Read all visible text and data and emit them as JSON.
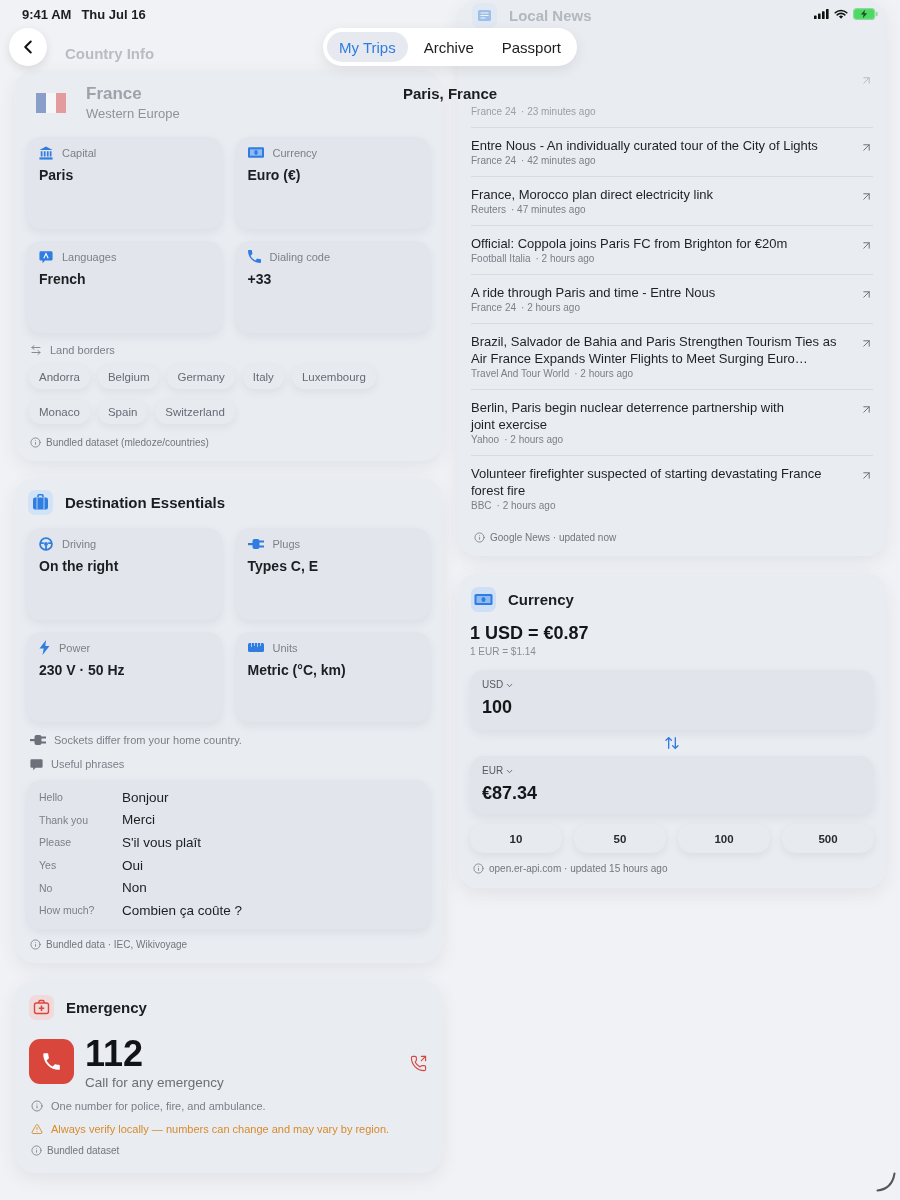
{
  "status_bar": {
    "time": "9:41 AM",
    "date": "Thu Jul 16"
  },
  "nav": {
    "title": "Country Info",
    "tabs": [
      {
        "label": "My Trips",
        "selected": true
      },
      {
        "label": "Archive",
        "selected": false
      },
      {
        "label": "Passport",
        "selected": false
      }
    ],
    "location": "Paris, France"
  },
  "country": {
    "name": "France",
    "region": "Western Europe",
    "facts": [
      {
        "kind": "capital",
        "label": "Capital",
        "value": "Paris"
      },
      {
        "kind": "currency",
        "label": "Currency",
        "value": "Euro (€)"
      },
      {
        "kind": "languages",
        "label": "Languages",
        "value": "French"
      },
      {
        "kind": "dialing",
        "label": "Dialing code",
        "value": "+33"
      }
    ],
    "borders": {
      "label": "Land borders",
      "countries": [
        "Andorra",
        "Belgium",
        "Germany",
        "Italy",
        "Luxembourg",
        "Monaco",
        "Spain",
        "Switzerland"
      ]
    },
    "source": "Bundled dataset (mledoze/countries)"
  },
  "essentials": {
    "title": "Destination Essentials",
    "facts": [
      {
        "kind": "driving",
        "label": "Driving",
        "value": "On the right"
      },
      {
        "kind": "plugs",
        "label": "Plugs",
        "value": "Types C, E"
      },
      {
        "kind": "power",
        "label": "Power",
        "value": "230 V · 50 Hz"
      },
      {
        "kind": "units",
        "label": "Units",
        "value": "Metric (°C, km)"
      }
    ],
    "notes": [
      {
        "kind": "plug",
        "text": "Sockets differ from your home country."
      }
    ],
    "phrases": {
      "label": "Useful phrases",
      "rows": [
        {
          "english": "Hello",
          "local": "Bonjour"
        },
        {
          "english": "Thank you",
          "local": "Merci"
        },
        {
          "english": "Please",
          "local": "S'il vous plaît"
        },
        {
          "english": "Yes",
          "local": "Oui"
        },
        {
          "english": "No",
          "local": "Non"
        },
        {
          "english": "How much?",
          "local": "Combien ça coûte ?"
        }
      ]
    },
    "source": "Bundled data · IEC, Wikivoyage"
  },
  "emergency": {
    "title": "Emergency",
    "number": "112",
    "caption": "Call for any emergency",
    "notes": [
      {
        "kind": "info",
        "text": "One number for police, fire, and ambulance."
      },
      {
        "kind": "warning",
        "text": "Always verify locally — numbers can change and may vary by region."
      }
    ],
    "source": "Bundled dataset"
  },
  "news": {
    "title": "Local News",
    "items": [
      {
        "faded": true,
        "source": "France 24",
        "time": "· 23 minutes ago"
      },
      {
        "faded": false,
        "title": "Entre Nous - An individually curated tour of the City of Lights",
        "source": "France 24",
        "time": "· 42 minutes ago"
      },
      {
        "faded": false,
        "title": "France, Morocco plan direct electricity link",
        "source": "Reuters",
        "time": "· 47 minutes ago"
      },
      {
        "faded": false,
        "title": "Official: Coppola joins Paris FC from Brighton for €20m",
        "source": "Football Italia",
        "time": "· 2 hours ago"
      },
      {
        "faded": false,
        "title": "A ride through Paris and time - Entre Nous",
        "source": "France 24",
        "time": "· 2 hours ago"
      },
      {
        "faded": false,
        "title": "Brazil, Salvador de Bahia and Paris Strengthen Tourism Ties as Air France Expands Winter Flights to Meet Surging Euro…",
        "source": "Travel And Tour World",
        "time": "· 2 hours ago"
      },
      {
        "faded": false,
        "title": "Berlin, Paris begin nuclear deterrence partnership with joint exercise",
        "source": "Yahoo",
        "time": "· 2 hours ago"
      },
      {
        "faded": false,
        "title": "Volunteer firefighter suspected of starting devastating France forest fire",
        "source": "BBC",
        "time": "· 2 hours ago"
      }
    ],
    "footer": "Google News · updated now"
  },
  "currency": {
    "title": "Currency",
    "rate": "1 USD = €0.87",
    "inverse": "1 EUR = $1.14",
    "fields": [
      {
        "code": "USD",
        "amount": "100"
      },
      {
        "code": "EUR",
        "amount": "€87.34"
      }
    ],
    "presets": [
      "10",
      "50",
      "100",
      "500"
    ],
    "source": "open.er-api.com · updated 15 hours ago"
  }
}
